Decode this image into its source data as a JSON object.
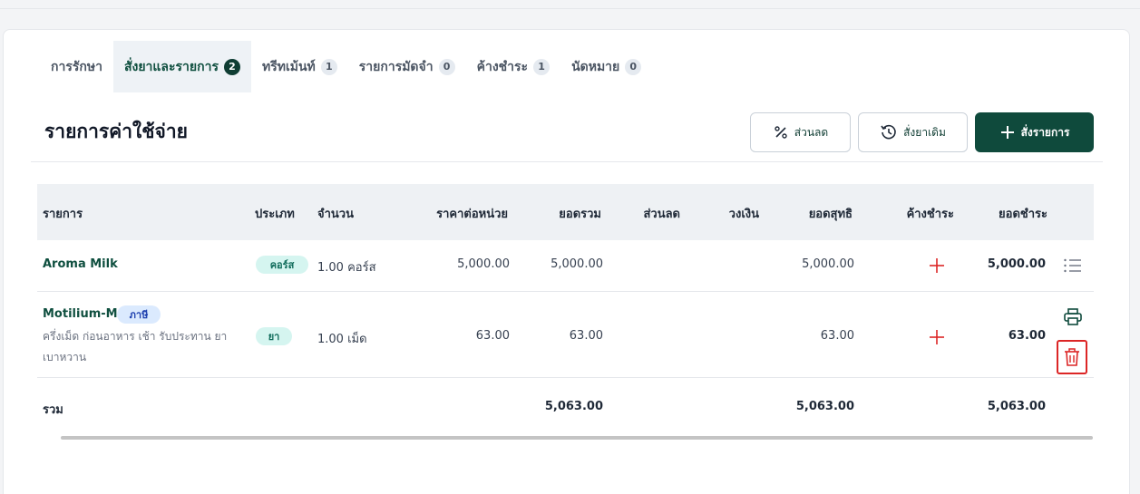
{
  "tabs": [
    {
      "label": "การรักษา",
      "count": ""
    },
    {
      "label": "สั่งยาและรายการ",
      "count": "2"
    },
    {
      "label": "ทรีทเม้นท์",
      "count": "1"
    },
    {
      "label": "รายการมัดจำ",
      "count": "0"
    },
    {
      "label": "ค้างชำระ",
      "count": "1"
    },
    {
      "label": "นัดหมาย",
      "count": "0"
    }
  ],
  "section": {
    "title": "รายการค่าใช้จ่าย"
  },
  "actions": {
    "discount": "ส่วนลด",
    "reorder": "สั่งยาเดิม",
    "add_order": "สั่งรายการ"
  },
  "table": {
    "headers": [
      "รายการ",
      "ประเภท",
      "จำนวน",
      "ราคาต่อหน่วย",
      "ยอดรวม",
      "ส่วนลด",
      "วงเงิน",
      "ยอดสุทธิ",
      "ค้างชำระ",
      "ยอดชำระ"
    ],
    "rows": [
      {
        "name": "Aroma Milk",
        "tag": "",
        "note": "",
        "type": "คอร์ส",
        "qty": "1.00 คอร์ส",
        "unit_price": "5,000.00",
        "total": "5,000.00",
        "discount": "",
        "credit": "",
        "net": "5,000.00",
        "paid": "5,000.00"
      },
      {
        "name": "Motilium-M",
        "tag": "ภาษี",
        "note": "ครึ่งเม็ด ก่อนอาหาร เช้า รับประทาน ยาเบาหวาน",
        "type": "ยา",
        "qty": "1.00 เม็ด",
        "unit_price": "63.00",
        "total": "63.00",
        "discount": "",
        "credit": "",
        "net": "63.00",
        "paid": "63.00"
      }
    ],
    "summary": {
      "label": "รวม",
      "total": "5,063.00",
      "net": "5,063.00",
      "paid": "5,063.00"
    }
  },
  "colors": {
    "primary": "#0f4a3c",
    "danger": "#dc2626"
  },
  "icons": {
    "discount": "percent-icon",
    "reorder": "history-icon",
    "add": "plus-icon",
    "row_menu": "list-icon",
    "print": "printer-icon",
    "delete": "trash-icon",
    "outstanding_add": "plus-icon"
  }
}
